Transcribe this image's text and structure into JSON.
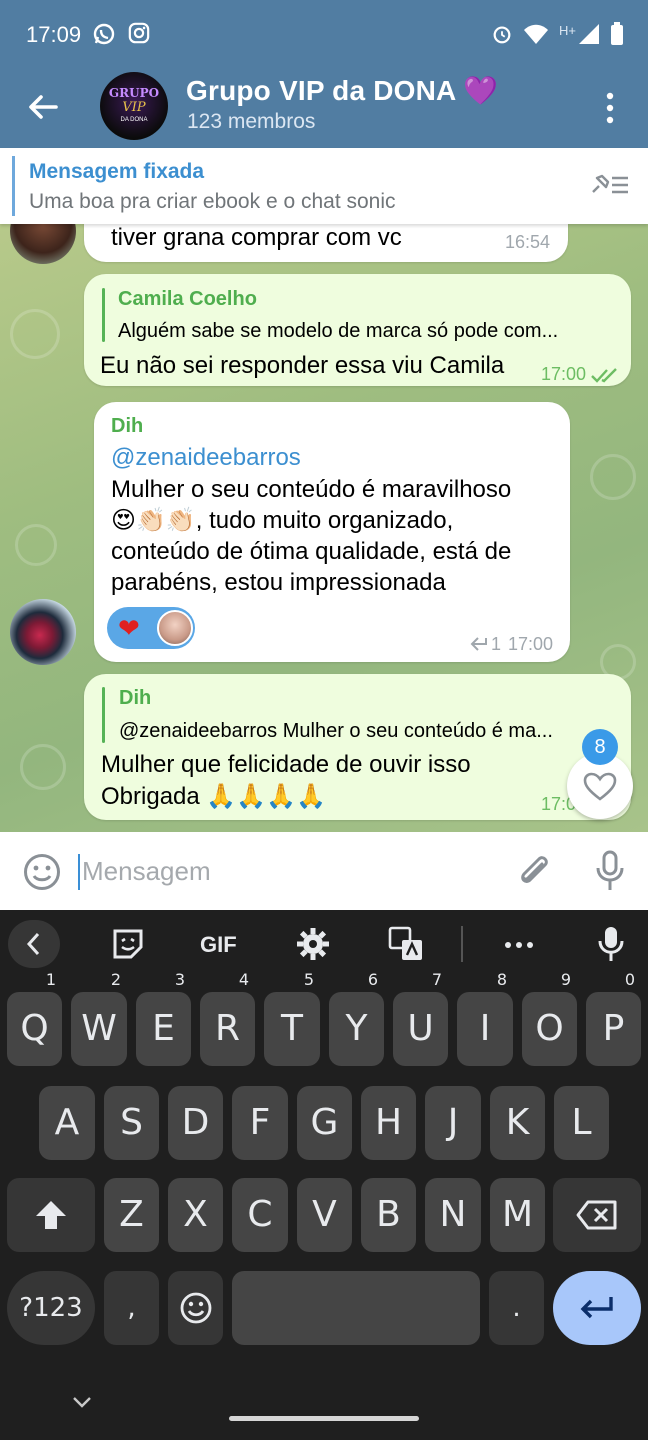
{
  "status_bar": {
    "time": "17:09",
    "network": "H+"
  },
  "header": {
    "title": "Grupo VIP da DONA 💜",
    "subtitle": "123 membros",
    "avatar_text": [
      "GRUPO",
      "VIP",
      "DA DONA"
    ]
  },
  "pinned": {
    "label": "Mensagem fixada",
    "text": "Uma boa pra criar ebook e o chat sonic"
  },
  "messages": [
    {
      "text": "tiver grana comprar com vc",
      "time": "16:54"
    },
    {
      "reply_name": "Camila Coelho",
      "reply_text": "Alguém sabe se modelo de marca só pode com...",
      "text": "Eu não sei responder essa viu Camila",
      "time": "17:00"
    },
    {
      "sender": "Dih",
      "mention": "@zenaideebarros",
      "lines": [
        "Mulher  o seu conteúdo é maravilhoso",
        "😍👏🏻👏🏻, tudo muito organizado,",
        "conteúdo de ótima qualidade, está de",
        "parabéns, estou impressionada"
      ],
      "reply_count": "1",
      "time": "17:00"
    },
    {
      "reply_name": "Dih",
      "reply_text": "@zenaideebarros  Mulher  o seu conteúdo é ma...",
      "lines": [
        "Mulher que felicidade de ouvir isso",
        "Obrigada 🙏🙏🙏🙏"
      ],
      "time": "17:0"
    }
  ],
  "unread_badge": "8",
  "composer": {
    "placeholder": "Mensagem"
  },
  "keyboard": {
    "toolbar_gif": "GIF",
    "row1": [
      [
        "Q",
        "1"
      ],
      [
        "W",
        "2"
      ],
      [
        "E",
        "3"
      ],
      [
        "R",
        "4"
      ],
      [
        "T",
        "5"
      ],
      [
        "Y",
        "6"
      ],
      [
        "U",
        "7"
      ],
      [
        "I",
        "8"
      ],
      [
        "O",
        "9"
      ],
      [
        "P",
        "0"
      ]
    ],
    "row2": [
      "A",
      "S",
      "D",
      "F",
      "G",
      "H",
      "J",
      "K",
      "L"
    ],
    "row3": [
      "Z",
      "X",
      "C",
      "V",
      "B",
      "N",
      "M"
    ],
    "symbols": "?123",
    "comma": ",",
    "period": "."
  }
}
